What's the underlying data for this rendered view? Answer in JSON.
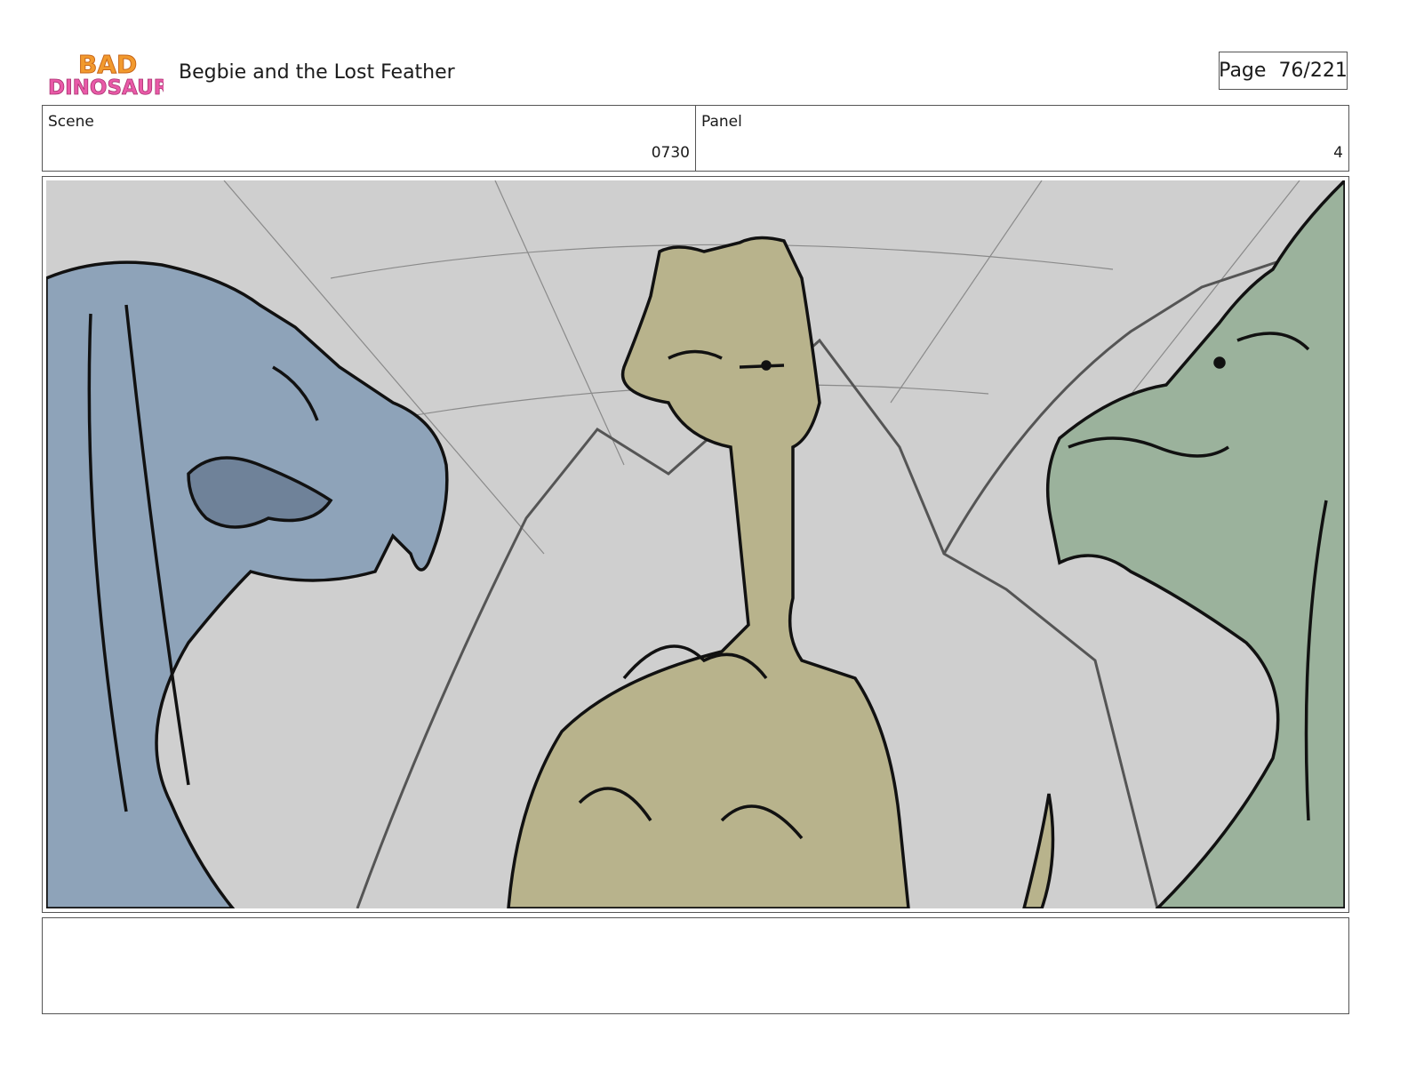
{
  "header": {
    "logo_text": "BAD DINOSAURS",
    "title": "Begbie and the Lost Feather",
    "page_label": "Page",
    "page_number": "76/221"
  },
  "info": {
    "scene_label": "Scene",
    "scene_value": "0730",
    "panel_label": "Panel",
    "panel_value": "4"
  },
  "panel_art": {
    "characters": [
      "blue dinosaur",
      "olive feathered dinosaur",
      "green dinosaur"
    ],
    "colors": {
      "background": "#cfcfcf",
      "blue_dino": "#8ea3b9",
      "olive_dino": "#b8b38c",
      "green_dino": "#9bb29c",
      "line": "#111111"
    }
  },
  "notes": {
    "text": ""
  }
}
